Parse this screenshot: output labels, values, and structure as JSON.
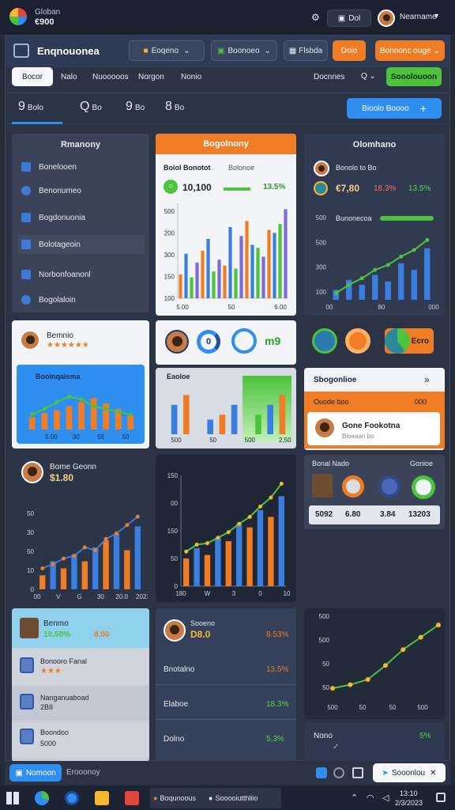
{
  "topbar": {
    "app_name": "Globan",
    "app_value": "€900",
    "search_btn": "Dol",
    "user_name": "Nearname"
  },
  "header": {
    "title": "Enqnouonea",
    "dropdown1": "Eoqeno",
    "dropdown2": "Boonoeo",
    "button_file": "Flsbda",
    "button_orange": "Doio",
    "button_cta": "Bonnonc ouge"
  },
  "nav": {
    "tabs": [
      "Bocor",
      "Nalo",
      "Nuooooos",
      "Norgon",
      "Nonio"
    ],
    "right_link": "Docnnes",
    "right_q": "Q",
    "green_btn": "Sooolouoon"
  },
  "statbar": {
    "items": [
      {
        "icon": "9",
        "label": "Bolo"
      },
      {
        "icon": "Q",
        "label": "Bo"
      },
      {
        "icon": "9",
        "label": "Bo"
      },
      {
        "icon": "8",
        "label": "Bo"
      }
    ],
    "button": "Bioolo Boooo"
  },
  "sidebar": {
    "title": "Rmanony",
    "items": [
      "Bonelooen",
      "Benonumeo",
      "Bogdonuonia",
      "Bolotageoin",
      "Norbonfoanonl",
      "Bogolaloin"
    ]
  },
  "card_center": {
    "title": "Bogolnony",
    "label1": "Boiol Bonotot",
    "label2": "Bolonoe",
    "value": "10,100",
    "pct": "13.5%",
    "x_ticks": [
      "5.00",
      "50",
      "6.00"
    ],
    "y_ticks": [
      "500",
      "200",
      "300",
      "150",
      "100"
    ]
  },
  "card_right": {
    "title": "Olomhano",
    "person_label": "Bonolo to Bo",
    "value": "€7,80",
    "pct_red": "18.3%",
    "pct_green": "13.5%",
    "bar_label": "Bunonecoa",
    "y_ticks": [
      "500",
      "500",
      "300",
      "100"
    ],
    "x_ticks": [
      "00",
      "80",
      "000"
    ]
  },
  "profile_card": {
    "name": "Bemnio",
    "stars": "★★★★★★",
    "chart_title": "Boolnqaisma",
    "x_ticks": [
      "5.00",
      "30",
      "56",
      "50"
    ]
  },
  "circles": {
    "num": "0",
    "tag": "m9"
  },
  "right_circle_btn": "Ecro",
  "mid_chart": {
    "title": "Eaoloe",
    "x_ticks": [
      "500",
      "50",
      "500",
      "2,507"
    ]
  },
  "panel_right": {
    "title": "Sbogonlioe",
    "arrows": "»",
    "orange_left": "Ouode boo",
    "orange_right": "000",
    "person_name": "Gone Fookotna",
    "person_sub": "Bloeaan bo"
  },
  "left_chart": {
    "person": "Bome Geonn",
    "value": "$1.80",
    "y_ticks": [
      "50",
      "30",
      "50",
      "10",
      "0"
    ],
    "x_ticks": [
      "00",
      "V",
      "G",
      "30",
      "20.0",
      "2023"
    ]
  },
  "dark_chart": {
    "y_ticks": [
      "150",
      "00",
      "150",
      "50",
      "0"
    ],
    "x_ticks": [
      "180",
      "W",
      "3",
      "0",
      "10"
    ]
  },
  "media_card": {
    "label": "Bonal Nado",
    "label_r": "Gonioe",
    "values": [
      "5092",
      "6.80",
      "3.84",
      "13203"
    ]
  },
  "list_card": {
    "header_name": "Benmo",
    "header_pct": "10,50%",
    "header_val": "8.00",
    "items": [
      {
        "name": "Bonooro Fanal",
        "sub": "★★★"
      },
      {
        "name": "Nanganuaboad",
        "sub": "2BII"
      },
      {
        "name": "Boondoo",
        "sub": "5000"
      }
    ]
  },
  "metrics_card": {
    "name": "Sooeno",
    "value": "D8.0",
    "pct": "8.53%",
    "rows": [
      {
        "label": "Bnotalno",
        "val": "13.5%"
      },
      {
        "label": "Elaboe",
        "val": "18.3%"
      },
      {
        "label": "Dolno",
        "val": "5.3%"
      }
    ]
  },
  "line_card": {
    "y_ticks": [
      "500",
      "500",
      "50",
      "50"
    ],
    "x_ticks": [
      "500",
      "50",
      "50",
      "500"
    ]
  },
  "small_card": {
    "label": "Nono",
    "val": "5%"
  },
  "status_strip": {
    "left_btn": "Nomoon",
    "left_text": "Erooonoy",
    "right_btn": "Sooonlou"
  },
  "taskbar": {
    "app1": "Boqunoous",
    "app2": "Sooooiutthliio",
    "clock_time": "13:10",
    "clock_date": "2/3/2023"
  },
  "colors": {
    "orange": "#f07c26",
    "green": "#4cc23d",
    "blue": "#3a7ee0",
    "navy": "#2b3446",
    "accent_blue": "#2f8ff0"
  },
  "chart_data": [
    {
      "type": "bar",
      "title": "Bogolnony",
      "categories": [
        "1",
        "2",
        "3",
        "4",
        "5",
        "6",
        "7",
        "8",
        "9",
        "10",
        "11",
        "12",
        "13",
        "14",
        "15",
        "16",
        "17",
        "18",
        "19",
        "20"
      ],
      "series": [
        {
          "values": [
            80,
            150,
            70,
            120,
            160,
            200,
            90,
            130,
            110,
            240,
            100,
            210,
            260,
            180,
            170,
            140,
            230,
            220,
            250,
            300
          ]
        }
      ],
      "ylim": [
        0,
        320
      ]
    },
    {
      "type": "bar",
      "title": "Olomhano",
      "categories": [
        "1",
        "2",
        "3",
        "4",
        "5",
        "6",
        "7",
        "8"
      ],
      "series": [
        {
          "values": [
            60,
            120,
            90,
            150,
            110,
            220,
            180,
            310
          ]
        },
        {
          "name": "line",
          "values": [
            40,
            90,
            130,
            180,
            210,
            260,
            300,
            360
          ]
        }
      ],
      "ylim": [
        0,
        400
      ]
    },
    {
      "type": "bar",
      "title": "Bome Geonn",
      "categories": [
        "1",
        "2",
        "3",
        "4",
        "5",
        "6",
        "7",
        "8",
        "9",
        "10"
      ],
      "series": [
        {
          "values": [
            10,
            20,
            15,
            25,
            20,
            30,
            35,
            40,
            28,
            45
          ]
        },
        {
          "name": "line",
          "values": [
            15,
            18,
            22,
            24,
            30,
            28,
            36,
            40,
            46,
            52
          ]
        }
      ],
      "ylim": [
        0,
        60
      ]
    },
    {
      "type": "bar",
      "title": "",
      "categories": [
        "1",
        "2",
        "3",
        "4",
        "5",
        "6",
        "7",
        "8",
        "9",
        "10"
      ],
      "series": [
        {
          "values": [
            40,
            55,
            45,
            70,
            65,
            90,
            85,
            110,
            100,
            130
          ]
        },
        {
          "name": "line",
          "values": [
            50,
            60,
            62,
            70,
            78,
            90,
            100,
            115,
            128,
            148
          ]
        }
      ],
      "ylim": [
        0,
        160
      ]
    },
    {
      "type": "line",
      "title": "",
      "x": [
        1,
        2,
        3,
        4,
        5,
        6,
        7
      ],
      "series": [
        {
          "values": [
            40,
            60,
            90,
            170,
            260,
            330,
            400
          ]
        }
      ],
      "ylim": [
        0,
        450
      ]
    }
  ]
}
